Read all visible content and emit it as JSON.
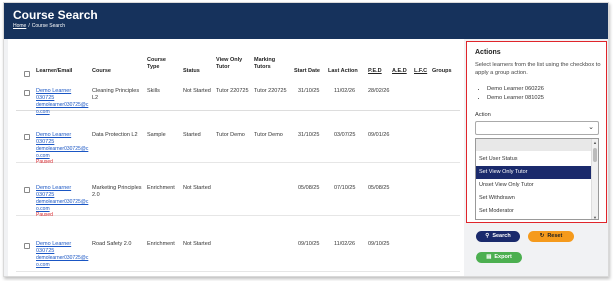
{
  "page": {
    "title": "Course Search",
    "breadcrumb": [
      "Home",
      "Course Search"
    ]
  },
  "table": {
    "headers": {
      "learner": "Learner/Email",
      "course": "Course",
      "course_type": "Course Type",
      "status": "Status",
      "view_only_tutor": "View Only Tutor",
      "marking_tutors": "Marking Tutors",
      "start_date": "Start Date",
      "last_action": "Last Action",
      "ped": "P.E.D",
      "aed": "A.E.D",
      "lfc": "L.F.C",
      "groups": "Groups"
    },
    "rows": [
      {
        "learner_name": "Demo Learner 030725",
        "email": "demolearner030725@c o.com",
        "paused": "",
        "course": "Cleaning Principles L2",
        "course_type": "Skills",
        "status": "Not Started",
        "view_only_tutor": "Tutor 220725",
        "marking_tutors": "Tutor 220725",
        "start_date": "31/10/25",
        "last_action": "11/02/26",
        "ped": "28/02/26"
      },
      {
        "learner_name": "Demo Learner 030725",
        "email": "demolearner030725@c o.com",
        "paused": "Paused",
        "course": "Data Protection L2",
        "course_type": "Sample",
        "status": "Started",
        "view_only_tutor": "Tutor Demo",
        "marking_tutors": "Tutor Demo",
        "start_date": "31/10/25",
        "last_action": "03/07/25",
        "ped": "09/01/26"
      },
      {
        "learner_name": "Demo Learner 030725",
        "email": "demolearner030725@c o.com",
        "paused": "Paused",
        "course": "Marketing Principles 2.0",
        "course_type": "Enrichment",
        "status": "Not Started",
        "view_only_tutor": "",
        "marking_tutors": "",
        "start_date": "05/08/25",
        "last_action": "07/10/25",
        "ped": "05/08/25"
      },
      {
        "learner_name": "Demo Learner 030725",
        "email": "demolearner030725@c o.com",
        "paused": "",
        "course": "Road Safety 2.0",
        "course_type": "Enrichment",
        "status": "Not Started",
        "view_only_tutor": "",
        "marking_tutors": "",
        "start_date": "09/10/25",
        "last_action": "11/02/26",
        "ped": "09/10/25"
      }
    ]
  },
  "actions": {
    "title": "Actions",
    "description": "Select learners from the list using the checkbox to apply a group action.",
    "selected": [
      "Demo Learner 060226",
      "Demo Learner 081025"
    ],
    "action_label": "Action",
    "select_value": "",
    "options": [
      "",
      "Set User Status",
      "Set View Only Tutor",
      "Unset View Only Tutor",
      "Set Withdrawn",
      "Set Moderator"
    ],
    "selected_option": "Set View Only Tutor"
  },
  "buttons": {
    "search": "Search",
    "reset": "Reset",
    "export": "Export"
  },
  "icons": {
    "search": "search-icon",
    "reset": "refresh-icon",
    "export": "file-icon"
  },
  "colors": {
    "header": "#16325c",
    "highlight_border": "#e0252b",
    "selected_option": "#1a2a6c",
    "search_button": "#1a2a6c",
    "reset_button": "#f59a1c",
    "export_button": "#4caf50",
    "paused": "#d9262c"
  }
}
